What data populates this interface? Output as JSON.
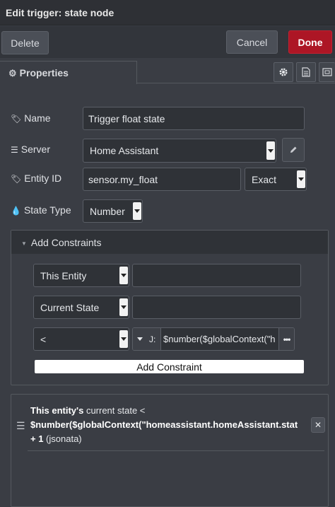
{
  "dialog": {
    "title": "Edit trigger: state node",
    "delete_label": "Delete",
    "cancel_label": "Cancel",
    "done_label": "Done"
  },
  "tabs": {
    "properties_label": "Properties",
    "icons": [
      "gear-icon",
      "description-icon",
      "appearance-icon"
    ]
  },
  "form": {
    "name": {
      "label": "Name",
      "value": "Trigger float state"
    },
    "server": {
      "label": "Server",
      "value": "Home Assistant"
    },
    "entity_id": {
      "label": "Entity ID",
      "value": "sensor.my_float",
      "match": "Exact"
    },
    "state_type": {
      "label": "State Type",
      "value": "Number"
    }
  },
  "constraints": {
    "header": "Add Constraints",
    "target_select": "This Entity",
    "target_value": "",
    "property_select": "Current State",
    "property_value": "",
    "comparator": "<",
    "value_type_label": "J:",
    "value": "$number($globalContext(\"h",
    "add_button": "Add Constraint"
  },
  "constraint_list": [
    {
      "subject": "This entity's",
      "text": " current state <",
      "expression": "$number($globalContext(\"homeassistant.homeAssistant.stat",
      "suffix_bold": "+ 1",
      "suffix": " (jsonata)"
    }
  ],
  "colors": {
    "background": "#3a3d44",
    "done_button": "#ad1625",
    "header": "#2e3035"
  }
}
